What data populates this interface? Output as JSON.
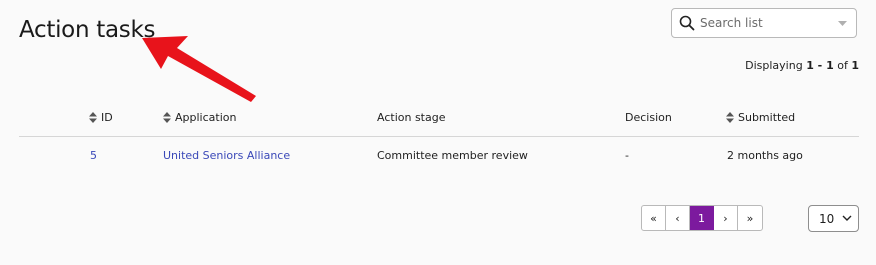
{
  "page": {
    "title": "Action tasks"
  },
  "search": {
    "placeholder": "Search list",
    "value": ""
  },
  "summary": {
    "prefix": "Displaying ",
    "range_start": "1",
    "range_sep": " - ",
    "range_end": "1",
    "of_label": " of ",
    "total": "1"
  },
  "table": {
    "headers": {
      "id": "ID",
      "application": "Application",
      "action_stage": "Action stage",
      "decision": "Decision",
      "submitted": "Submitted"
    },
    "rows": [
      {
        "id": "5",
        "application": "United Seniors Alliance",
        "action_stage": "Committee member review",
        "decision": "-",
        "submitted": "2 months ago"
      }
    ]
  },
  "pagination": {
    "first": "«",
    "prev": "‹",
    "current": "1",
    "next": "›",
    "last": "»"
  },
  "page_size": {
    "selected": "10"
  },
  "colors": {
    "link": "#3a48b8",
    "active_page": "#7c1a9e",
    "annotation": "#e8131b"
  },
  "icons": {
    "search": "search-icon",
    "sort": "sort-icon",
    "dropdown": "chevron-down-icon",
    "annotation": "arrow-annotation"
  }
}
